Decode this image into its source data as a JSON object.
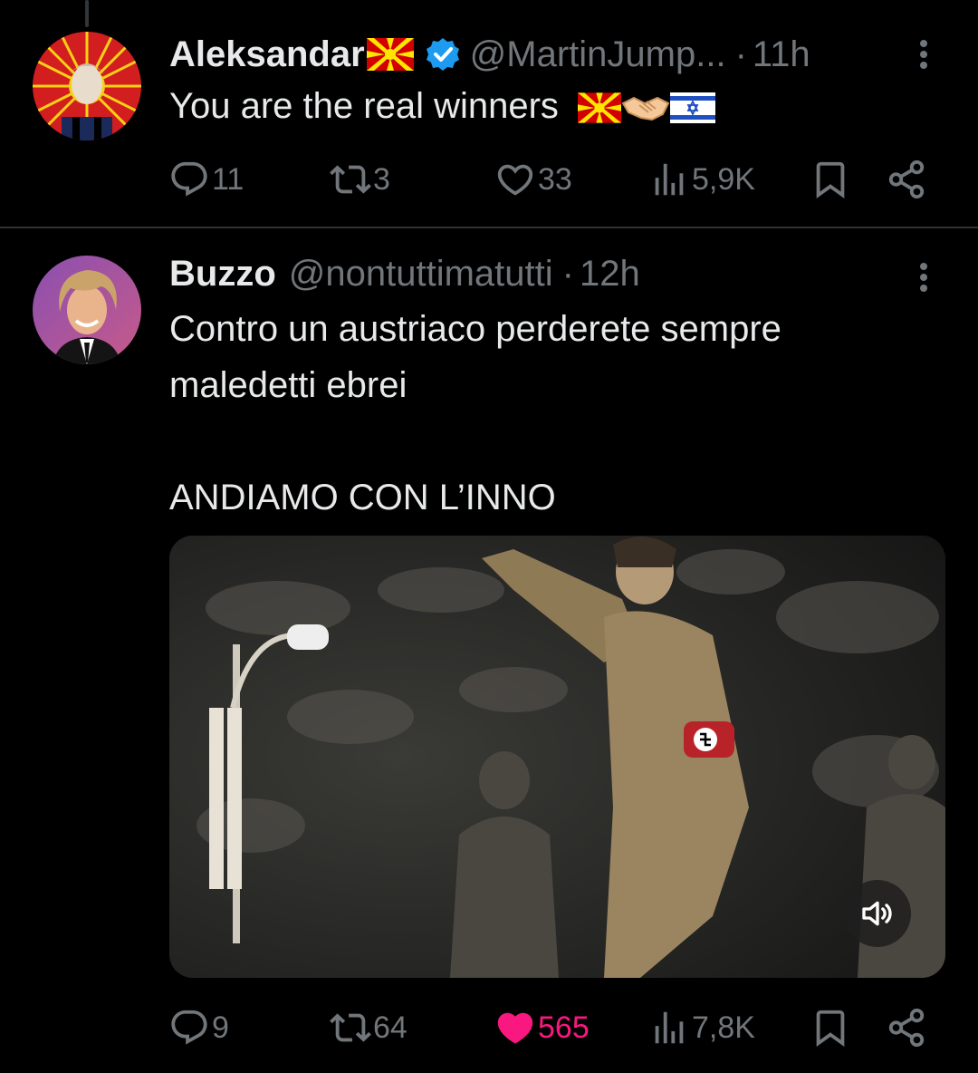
{
  "tweets": [
    {
      "author": {
        "name": "Aleksandar",
        "handle": "@MartinJump...",
        "time": "11h"
      },
      "text_lines": [
        "You are the real winners"
      ],
      "stats": {
        "replies": "11",
        "reposts": "3",
        "likes": "33",
        "views": "5,9K"
      },
      "liked": false
    },
    {
      "author": {
        "name": "Buzzo",
        "handle": "@nontuttimatutti",
        "time": "12h"
      },
      "text_lines": [
        "Contro un austriaco perderete sempre",
        "maledetti ebrei",
        "",
        "ANDIAMO CON L’INNO"
      ],
      "stats": {
        "replies": "9",
        "reposts": "64",
        "likes": "565",
        "views": "7,8K"
      },
      "liked": true
    }
  ],
  "separator": "·",
  "colors": {
    "background": "#000000",
    "text": "#e7e9ea",
    "secondary": "#71767b",
    "like": "#f91880",
    "verified": "#1d9bf0",
    "divider": "#2f3336"
  },
  "icons": [
    "reply-icon",
    "repost-icon",
    "like-icon",
    "views-icon",
    "bookmark-icon",
    "share-icon",
    "more-icon",
    "verified-icon",
    "volume-icon"
  ]
}
